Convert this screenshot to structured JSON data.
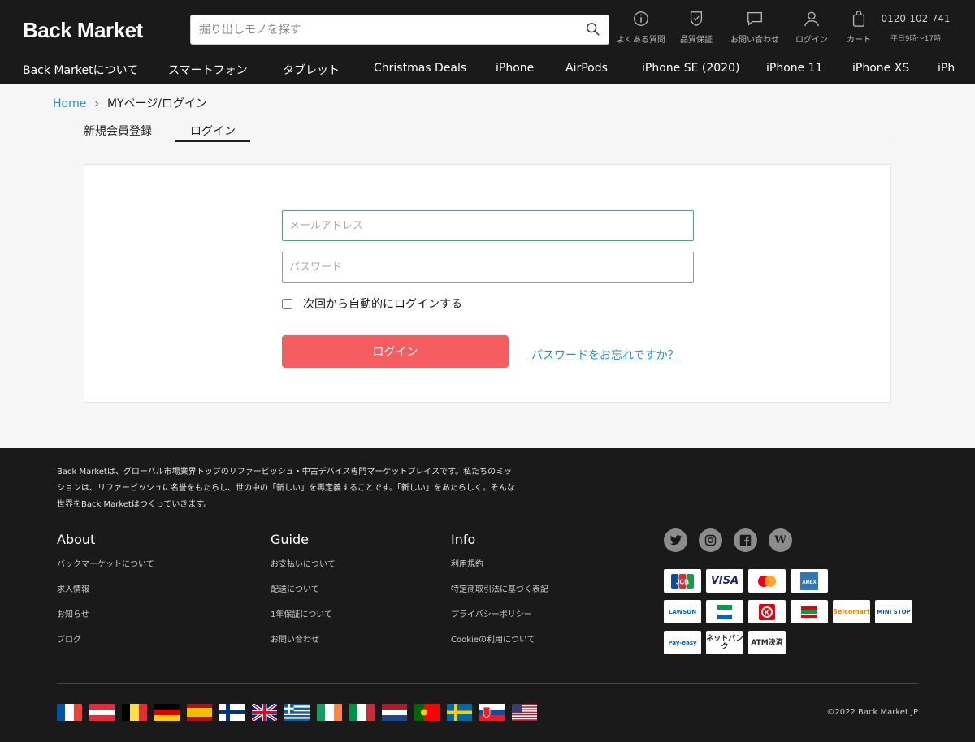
{
  "header": {
    "logo": "Back Market",
    "search_placeholder": "掘り出しモノを探す",
    "icons": [
      {
        "name": "faq",
        "label": "よくある質問"
      },
      {
        "name": "warranty",
        "label": "品質保証"
      },
      {
        "name": "contact",
        "label": "お問い合わせ"
      },
      {
        "name": "login",
        "label": "ログイン"
      },
      {
        "name": "cart",
        "label": "カート"
      }
    ],
    "phone": "0120-102-741",
    "hours": "平日9時〜17時"
  },
  "nav": [
    "Back Marketについて",
    "スマートフォン",
    "タブレット",
    "Christmas Deals",
    "iPhone",
    "AirPods",
    "iPhone SE (2020)",
    "iPhone 11",
    "iPhone XS",
    "iPh"
  ],
  "breadcrumb": {
    "home": "Home",
    "current": "MYページ/ログイン"
  },
  "tabs": {
    "register": "新規会員登録",
    "login": "ログイン"
  },
  "form": {
    "email_placeholder": "メールアドレス",
    "password_placeholder": "パスワード",
    "remember_label": "次回から自動的にログインする",
    "login_button": "ログイン",
    "forgot_link": "パスワードをお忘れですか？"
  },
  "footer": {
    "mission": "Back Marketは、グローバル市場業界トップのリファービッシュ・中古デバイス専門マーケットプレイスです。私たちのミッションは、リファービッシュに名誉をもたらし、世の中の「新しい」を再定義することです。「新しい」をあたらしく。そんな世界をBack Marketはつくっていきます。",
    "about": {
      "title": "About",
      "links": [
        "バックマーケットについて",
        "求人情報",
        "お知らせ",
        "ブログ"
      ]
    },
    "guide": {
      "title": "Guide",
      "links": [
        "お支払いについて",
        "配送について",
        "1年保証について",
        "お問い合わせ"
      ]
    },
    "info": {
      "title": "Info",
      "links": [
        "利用規約",
        "特定商取引法に基づく表記",
        "プライバシーポリシー",
        "Cookieの利用について"
      ]
    },
    "social": [
      "twitter",
      "instagram",
      "facebook",
      "wikipedia"
    ],
    "payments": [
      [
        "JCB",
        "VISA",
        "mastercard",
        "AMEX"
      ],
      [
        "LAWSON",
        "FamilyMart",
        "K",
        "MINISTOP-L",
        "Seicomart",
        "MINI STOP"
      ],
      [
        "Pay-easy",
        "ネットバンク",
        "ATM決済"
      ]
    ],
    "copyright": "©2022 Back Market JP"
  }
}
